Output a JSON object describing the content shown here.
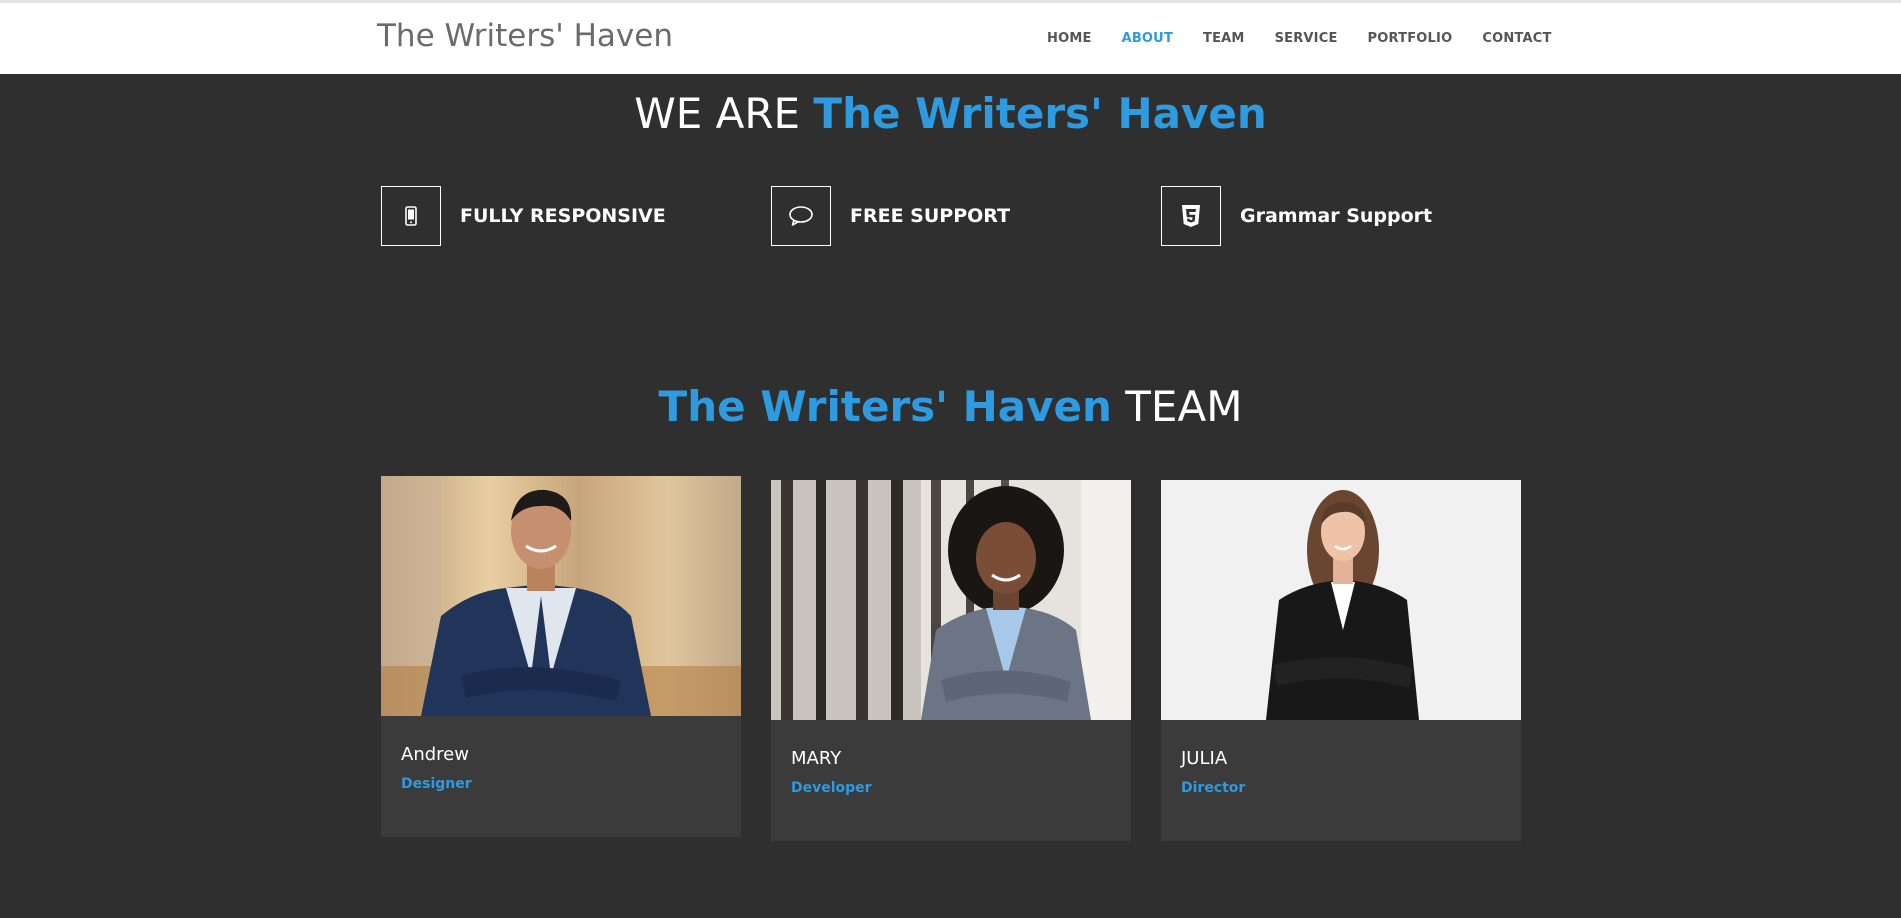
{
  "site": {
    "brand": "The Writers' Haven"
  },
  "nav": {
    "items": [
      {
        "label": "HOME",
        "active": false
      },
      {
        "label": "ABOUT",
        "active": true
      },
      {
        "label": "TEAM",
        "active": false
      },
      {
        "label": "SERVICE",
        "active": false
      },
      {
        "label": "PORTFOLIO",
        "active": false
      },
      {
        "label": "CONTACT",
        "active": false
      }
    ]
  },
  "about": {
    "title_prefix": "WE ARE",
    "title_accent": "The Writers' Haven",
    "features": [
      {
        "label": "FULLY RESPONSIVE",
        "icon": "mobile-icon"
      },
      {
        "label": "FREE SUPPORT",
        "icon": "chat-bubble-icon"
      },
      {
        "label": "Grammar Support",
        "icon": "html5-icon"
      }
    ]
  },
  "team": {
    "title_accent": "The Writers' Haven",
    "title_suffix": "TEAM",
    "members": [
      {
        "name": "Andrew",
        "role": "Designer",
        "photo": "man-in-navy-suit-photo"
      },
      {
        "name": "MARY",
        "role": "Developer",
        "photo": "woman-in-grey-suit-photo"
      },
      {
        "name": "JULIA",
        "role": "Director",
        "photo": "woman-in-black-suit-photo"
      }
    ]
  },
  "colors": {
    "accent": "#2e9ae0",
    "background": "#2f2f2f",
    "card": "#3b3b3b",
    "navbar": "#ffffff"
  }
}
